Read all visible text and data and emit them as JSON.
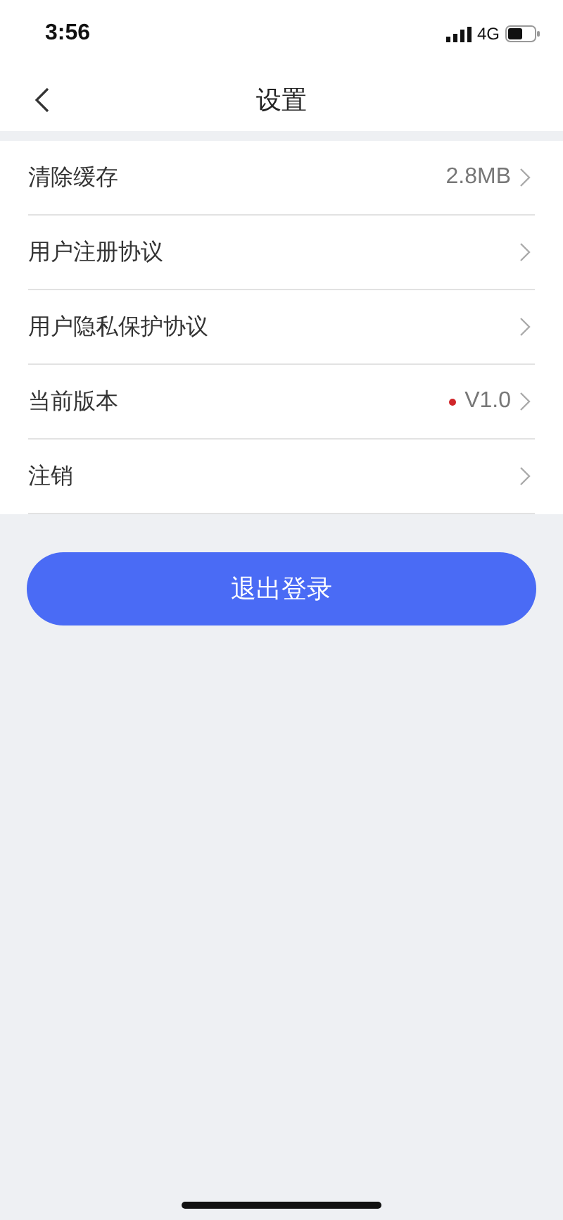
{
  "status_bar": {
    "time": "3:56",
    "network": "4G"
  },
  "nav": {
    "title": "设置"
  },
  "rows": [
    {
      "label": "清除缓存",
      "value": "2.8MB",
      "dot": false
    },
    {
      "label": "用户注册协议",
      "dot": false
    },
    {
      "label": "用户隐私保护协议",
      "dot": false
    },
    {
      "label": "当前版本",
      "value": "V1.0",
      "dot": true
    },
    {
      "label": "注销",
      "dot": false
    }
  ],
  "logout_button": {
    "label": "退出登录"
  }
}
